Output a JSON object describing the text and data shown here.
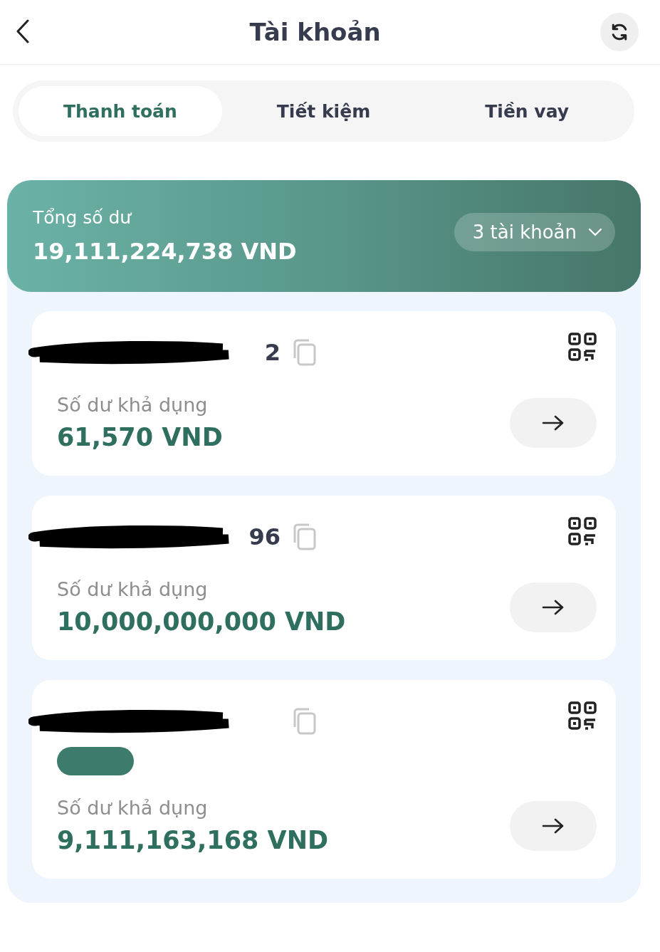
{
  "header": {
    "title": "Tài khoản"
  },
  "tabs": [
    {
      "label": "Thanh toán",
      "selected": true
    },
    {
      "label": "Tiết kiệm",
      "selected": false
    },
    {
      "label": "Tiền vay",
      "selected": false
    }
  ],
  "summary": {
    "label": "Tổng số dư",
    "total": "19,111,224,738 VND",
    "accounts_button": "3 tài khoản"
  },
  "accounts": [
    {
      "number": "2",
      "redacted": true,
      "badge": false,
      "balance_label": "Số dư khả dụng",
      "balance": "61,570 VND"
    },
    {
      "number": "96",
      "redacted": true,
      "badge": false,
      "balance_label": "Số dư khả dụng",
      "balance": "10,000,000,000 VND"
    },
    {
      "redacted": true,
      "badge": true,
      "balance_label": "Số dư khả dụng",
      "balance": "9,111,163,168 VND"
    }
  ]
}
